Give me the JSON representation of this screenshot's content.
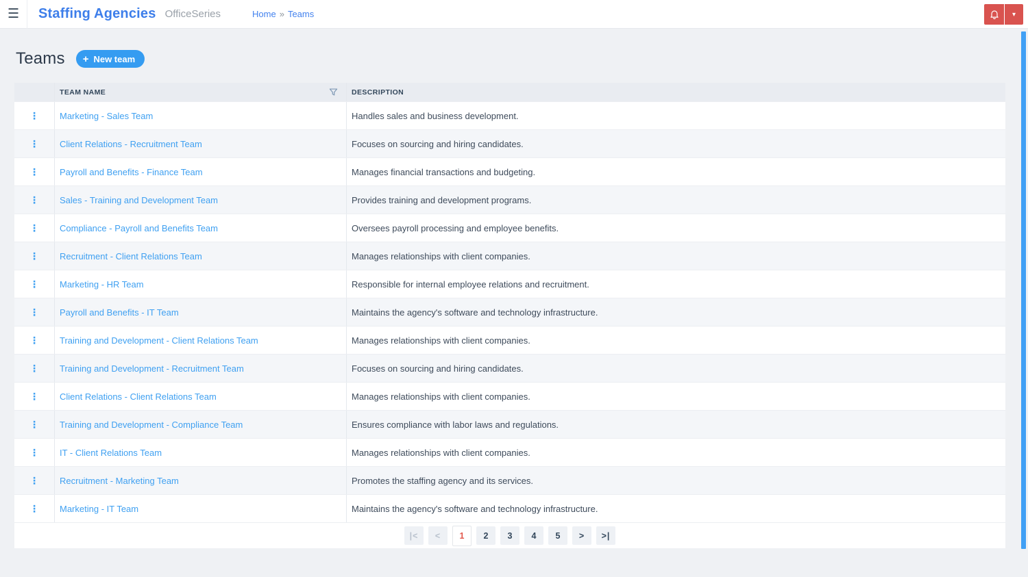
{
  "header": {
    "app_title": "Staffing Agencies",
    "app_subtitle": "OfficeSeries",
    "breadcrumb": {
      "home": "Home",
      "separator": "»",
      "current": "Teams"
    }
  },
  "page": {
    "title": "Teams",
    "new_team_label": "New team",
    "plus_glyph": "+"
  },
  "table": {
    "columns": [
      "TEAM NAME",
      "DESCRIPTION"
    ],
    "kebab_glyph": "⋮",
    "rows": [
      {
        "name": "Marketing - Sales Team",
        "description": "Handles sales and business development."
      },
      {
        "name": "Client Relations - Recruitment Team",
        "description": "Focuses on sourcing and hiring candidates."
      },
      {
        "name": "Payroll and Benefits - Finance Team",
        "description": "Manages financial transactions and budgeting."
      },
      {
        "name": "Sales - Training and Development Team",
        "description": "Provides training and development programs."
      },
      {
        "name": "Compliance - Payroll and Benefits Team",
        "description": "Oversees payroll processing and employee benefits."
      },
      {
        "name": "Recruitment - Client Relations Team",
        "description": "Manages relationships with client companies."
      },
      {
        "name": "Marketing - HR Team",
        "description": "Responsible for internal employee relations and recruitment."
      },
      {
        "name": "Payroll and Benefits - IT Team",
        "description": "Maintains the agency's software and technology infrastructure."
      },
      {
        "name": "Training and Development - Client Relations Team",
        "description": "Manages relationships with client companies."
      },
      {
        "name": "Training and Development - Recruitment Team",
        "description": "Focuses on sourcing and hiring candidates."
      },
      {
        "name": "Client Relations - Client Relations Team",
        "description": "Manages relationships with client companies."
      },
      {
        "name": "Training and Development - Compliance Team",
        "description": "Ensures compliance with labor laws and regulations."
      },
      {
        "name": "IT - Client Relations Team",
        "description": "Manages relationships with client companies."
      },
      {
        "name": "Recruitment - Marketing Team",
        "description": "Promotes the staffing agency and its services."
      },
      {
        "name": "Marketing - IT Team",
        "description": "Maintains the agency's software and technology infrastructure."
      }
    ]
  },
  "pagination": {
    "first_label": "|<",
    "prev_label": "<",
    "pages": [
      "1",
      "2",
      "3",
      "4",
      "5"
    ],
    "current_page": "1",
    "next_label": ">",
    "last_label": ">|"
  },
  "icons": {
    "hamburger_glyph": "☰",
    "caret_down_glyph": "▾"
  },
  "colors": {
    "brand_blue": "#3d7eea",
    "accent_blue": "#359cf1",
    "link_blue": "#3fa0f1",
    "alert_red": "#d9534f",
    "current_page_red": "#e2574c",
    "scrollbar_blue": "#41a0f5",
    "page_background": "#eff1f4"
  }
}
